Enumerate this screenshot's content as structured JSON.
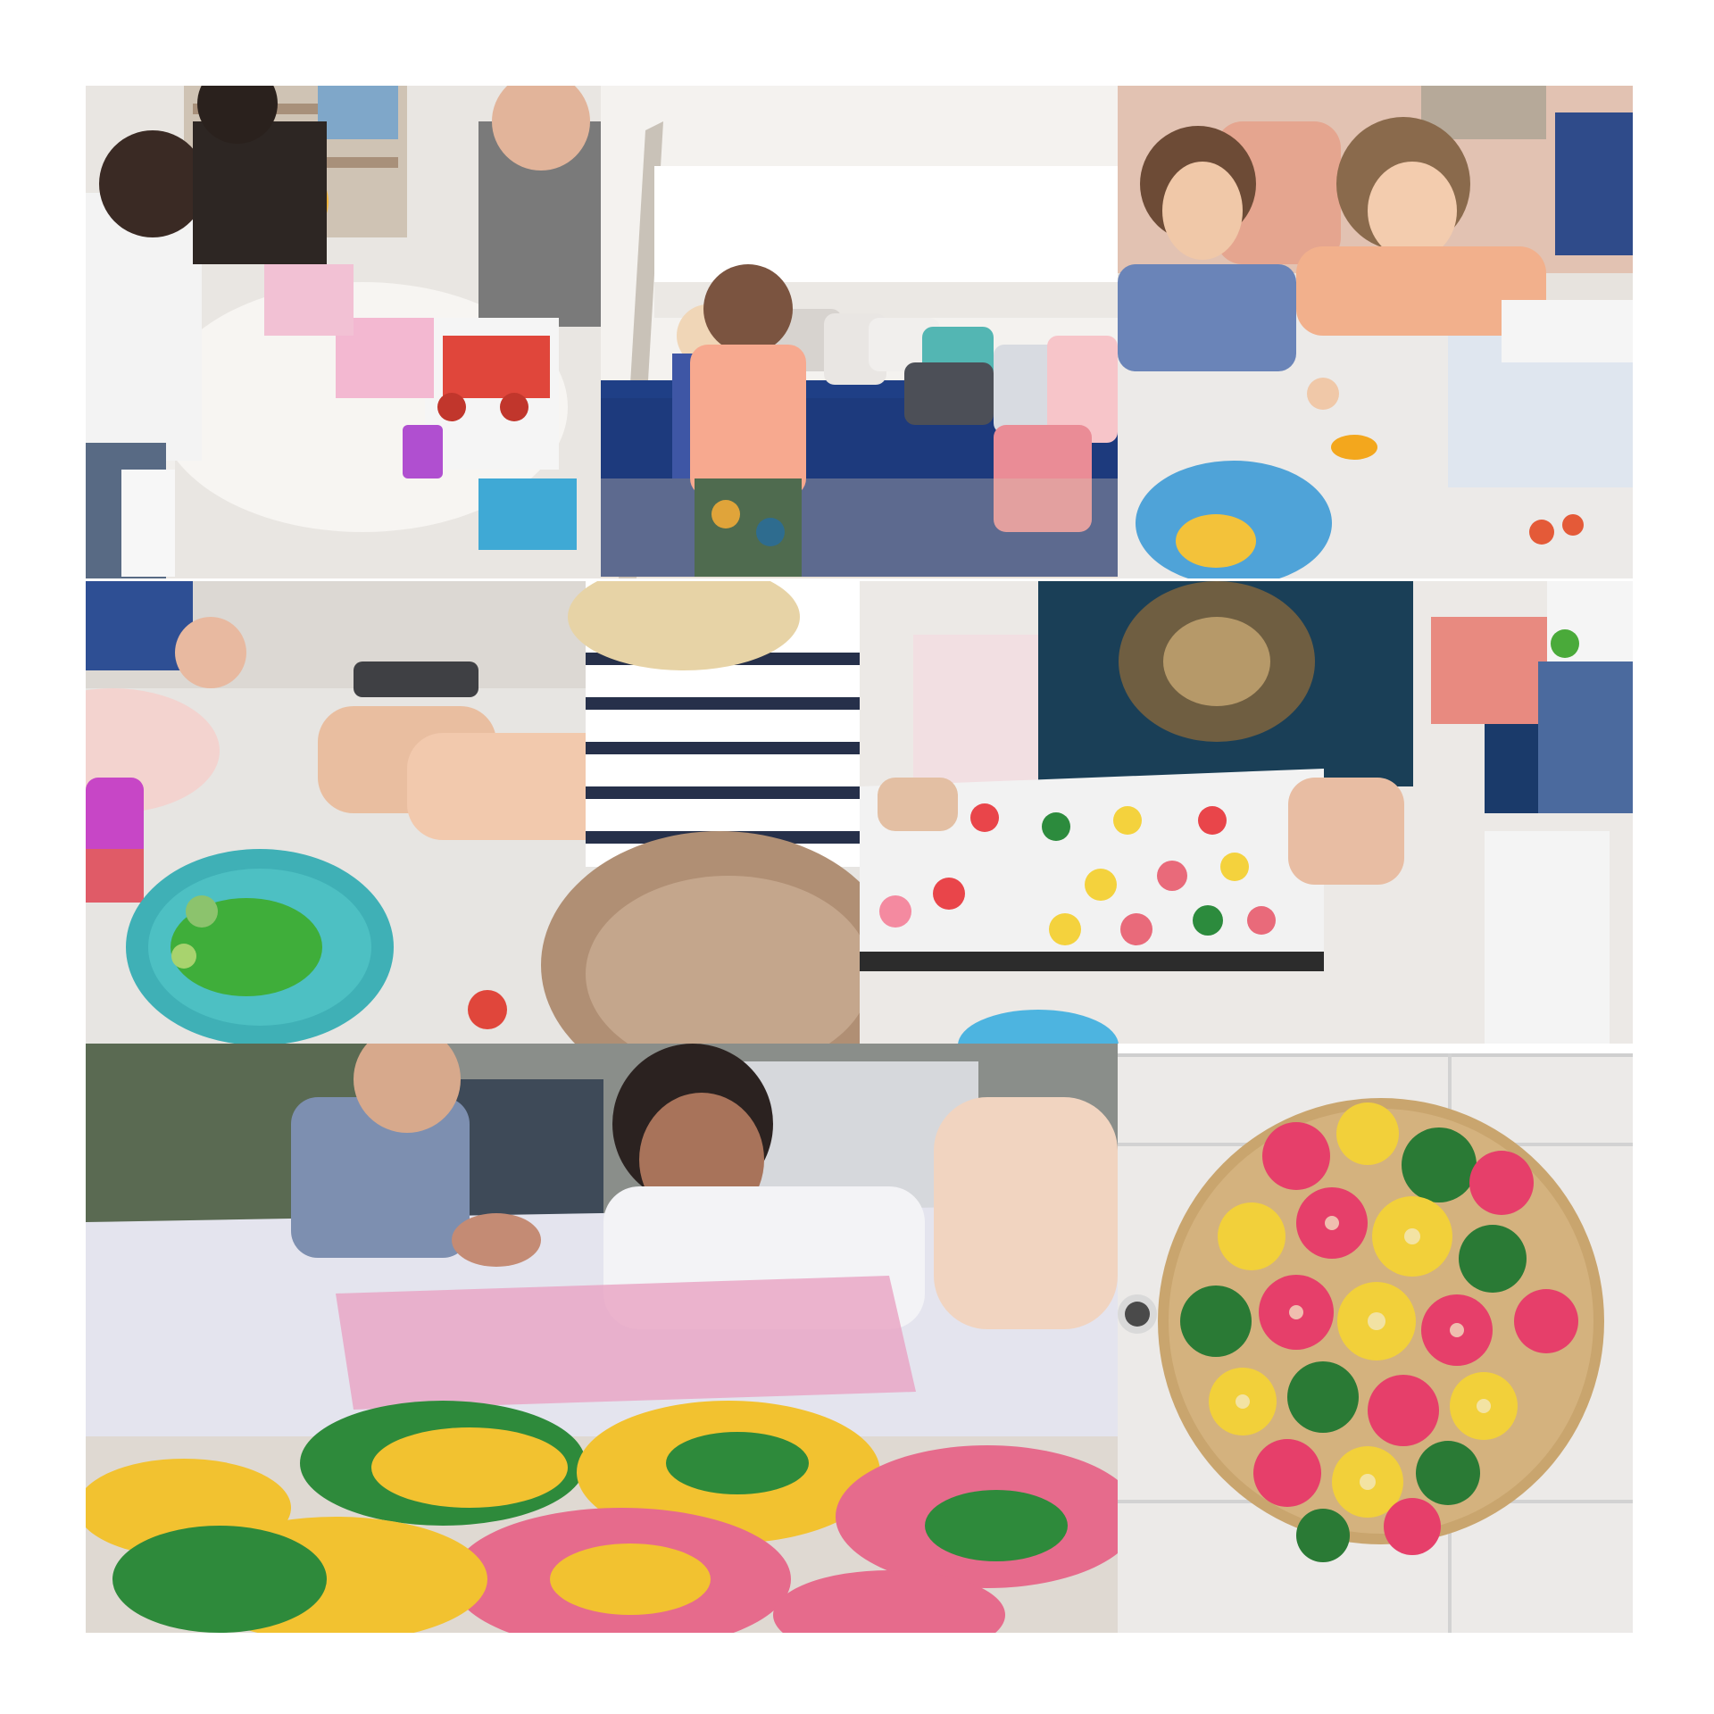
{
  "collage": {
    "background_color": "#ffffff",
    "photos": [
      {
        "subject": "children-at-round-table",
        "palette": [
          "#e9e6e2",
          "#f4f1ee",
          "#c44a3a",
          "#b04fd0",
          "#6e6e6e"
        ]
      },
      {
        "subject": "child-by-teepee-bed",
        "palette": [
          "#f2f0ed",
          "#1f3f86",
          "#f7a98f",
          "#e77d8a",
          "#53b6b3"
        ]
      },
      {
        "subject": "boys-shaping-dough",
        "palette": [
          "#e6e4e2",
          "#f2b08c",
          "#6a84b8",
          "#dcd3c8",
          "#f3a71d"
        ]
      },
      {
        "subject": "green-dough-on-plate",
        "palette": [
          "#e7e5e2",
          "#3fb0b6",
          "#3fae3a",
          "#c746c6",
          "#e8b9a0"
        ]
      },
      {
        "subject": "tray-of-unbaked-cookies",
        "palette": [
          "#ece9e6",
          "#1a3f57",
          "#e9454a",
          "#f4d23d",
          "#2c8b3d"
        ]
      },
      {
        "subject": "kids-with-baked-cookies",
        "palette": [
          "#ecebf0",
          "#7d8fb0",
          "#e8a3c3",
          "#f2c230",
          "#2e8a3b"
        ]
      },
      {
        "subject": "cookies-on-wooden-board",
        "palette": [
          "#eceae8",
          "#c9a56e",
          "#e63f6a",
          "#f2d03a",
          "#2a7a35"
        ]
      }
    ]
  }
}
